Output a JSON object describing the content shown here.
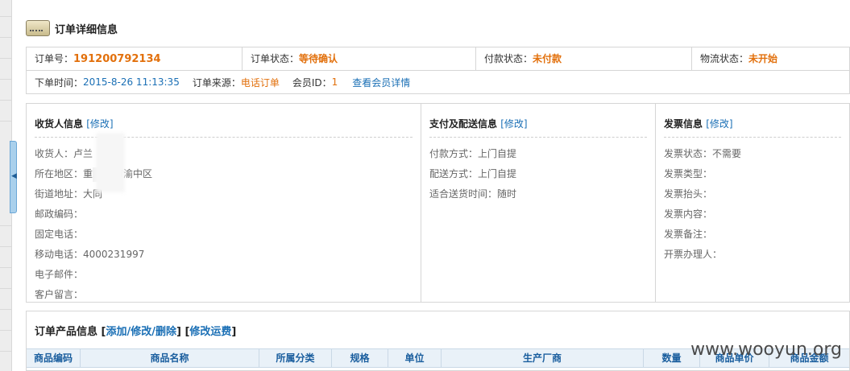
{
  "header": {
    "title": "订单详细信息"
  },
  "order": {
    "no_label": "订单号：",
    "no_value": "191200792134",
    "status_label": "订单状态：",
    "status_value": "等待确认",
    "pay_label": "付款状态：",
    "pay_value": "未付款",
    "ship_label": "物流状态：",
    "ship_value": "未开始",
    "time_label": "下单时间：",
    "time_value": "2015-8-26 11:13:35",
    "source_label": "订单来源：",
    "source_value": "电话订单",
    "member_label": "会员ID：",
    "member_value": "1",
    "member_link": "查看会员详情"
  },
  "receiver": {
    "title": "收货人信息",
    "edit": "[修改]",
    "name": "收货人：卢兰",
    "region": "所在地区：重",
    "region_tail": "市渝中区",
    "street": "街道地址：大同",
    "zip": "邮政编码：",
    "phone": "固定电话：",
    "mobile": "移动电话：4000231997",
    "email": "电子邮件：",
    "message": "客户留言："
  },
  "delivery": {
    "title": "支付及配送信息",
    "edit": "[修改]",
    "pay_method": "付款方式：上门自提",
    "ship_method": "配送方式：上门自提",
    "ship_time": "适合送货时间：随时"
  },
  "invoice": {
    "title": "发票信息",
    "edit": "[修改]",
    "status": "发票状态：不需要",
    "type": "发票类型：",
    "head": "发票抬头：",
    "content": "发票内容：",
    "note": "发票备注：",
    "handler": "开票办理人："
  },
  "products": {
    "title": "订单产品信息",
    "link1": "添加/修改/删除",
    "link2": "修改运费",
    "columns": [
      "商品编码",
      "商品名称",
      "所属分类",
      "规格",
      "单位",
      "生产厂商",
      "数量",
      "商品单价",
      "商品金额"
    ]
  },
  "watermark": "www.wooyun.org"
}
